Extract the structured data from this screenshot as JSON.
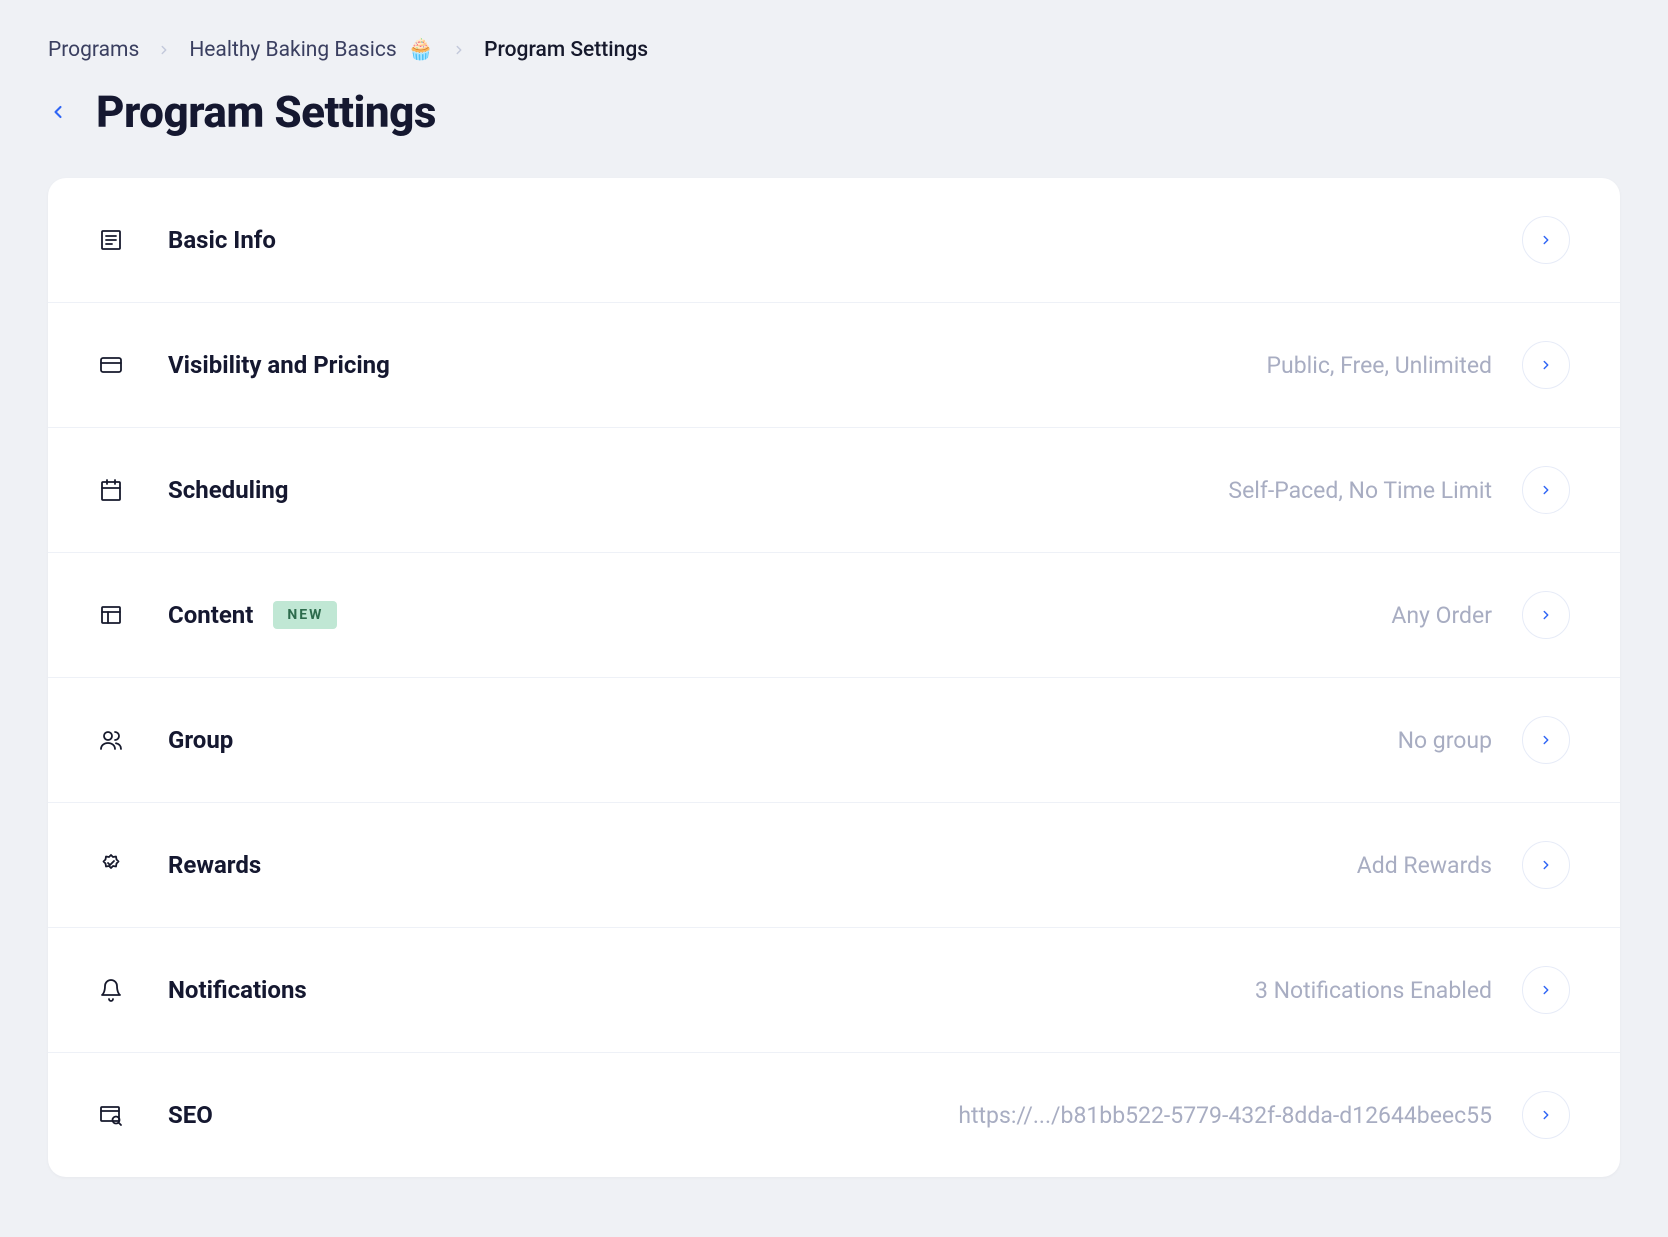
{
  "breadcrumb": {
    "items": [
      {
        "label": "Programs"
      },
      {
        "label": "Healthy Baking Basics",
        "emoji": "🧁"
      },
      {
        "label": "Program Settings",
        "current": true
      }
    ]
  },
  "page_title": "Program Settings",
  "settings": [
    {
      "label": "Basic Info",
      "value": "",
      "badge": ""
    },
    {
      "label": "Visibility and Pricing",
      "value": "Public, Free, Unlimited",
      "badge": ""
    },
    {
      "label": "Scheduling",
      "value": "Self-Paced, No Time Limit",
      "badge": ""
    },
    {
      "label": "Content",
      "value": "Any Order",
      "badge": "NEW"
    },
    {
      "label": "Group",
      "value": "No group",
      "badge": ""
    },
    {
      "label": "Rewards",
      "value": "Add Rewards",
      "badge": ""
    },
    {
      "label": "Notifications",
      "value": "3 Notifications Enabled",
      "badge": ""
    },
    {
      "label": "SEO",
      "value": "https://.../b81bb522-5779-432f-8dda-d12644beec55",
      "badge": ""
    }
  ]
}
